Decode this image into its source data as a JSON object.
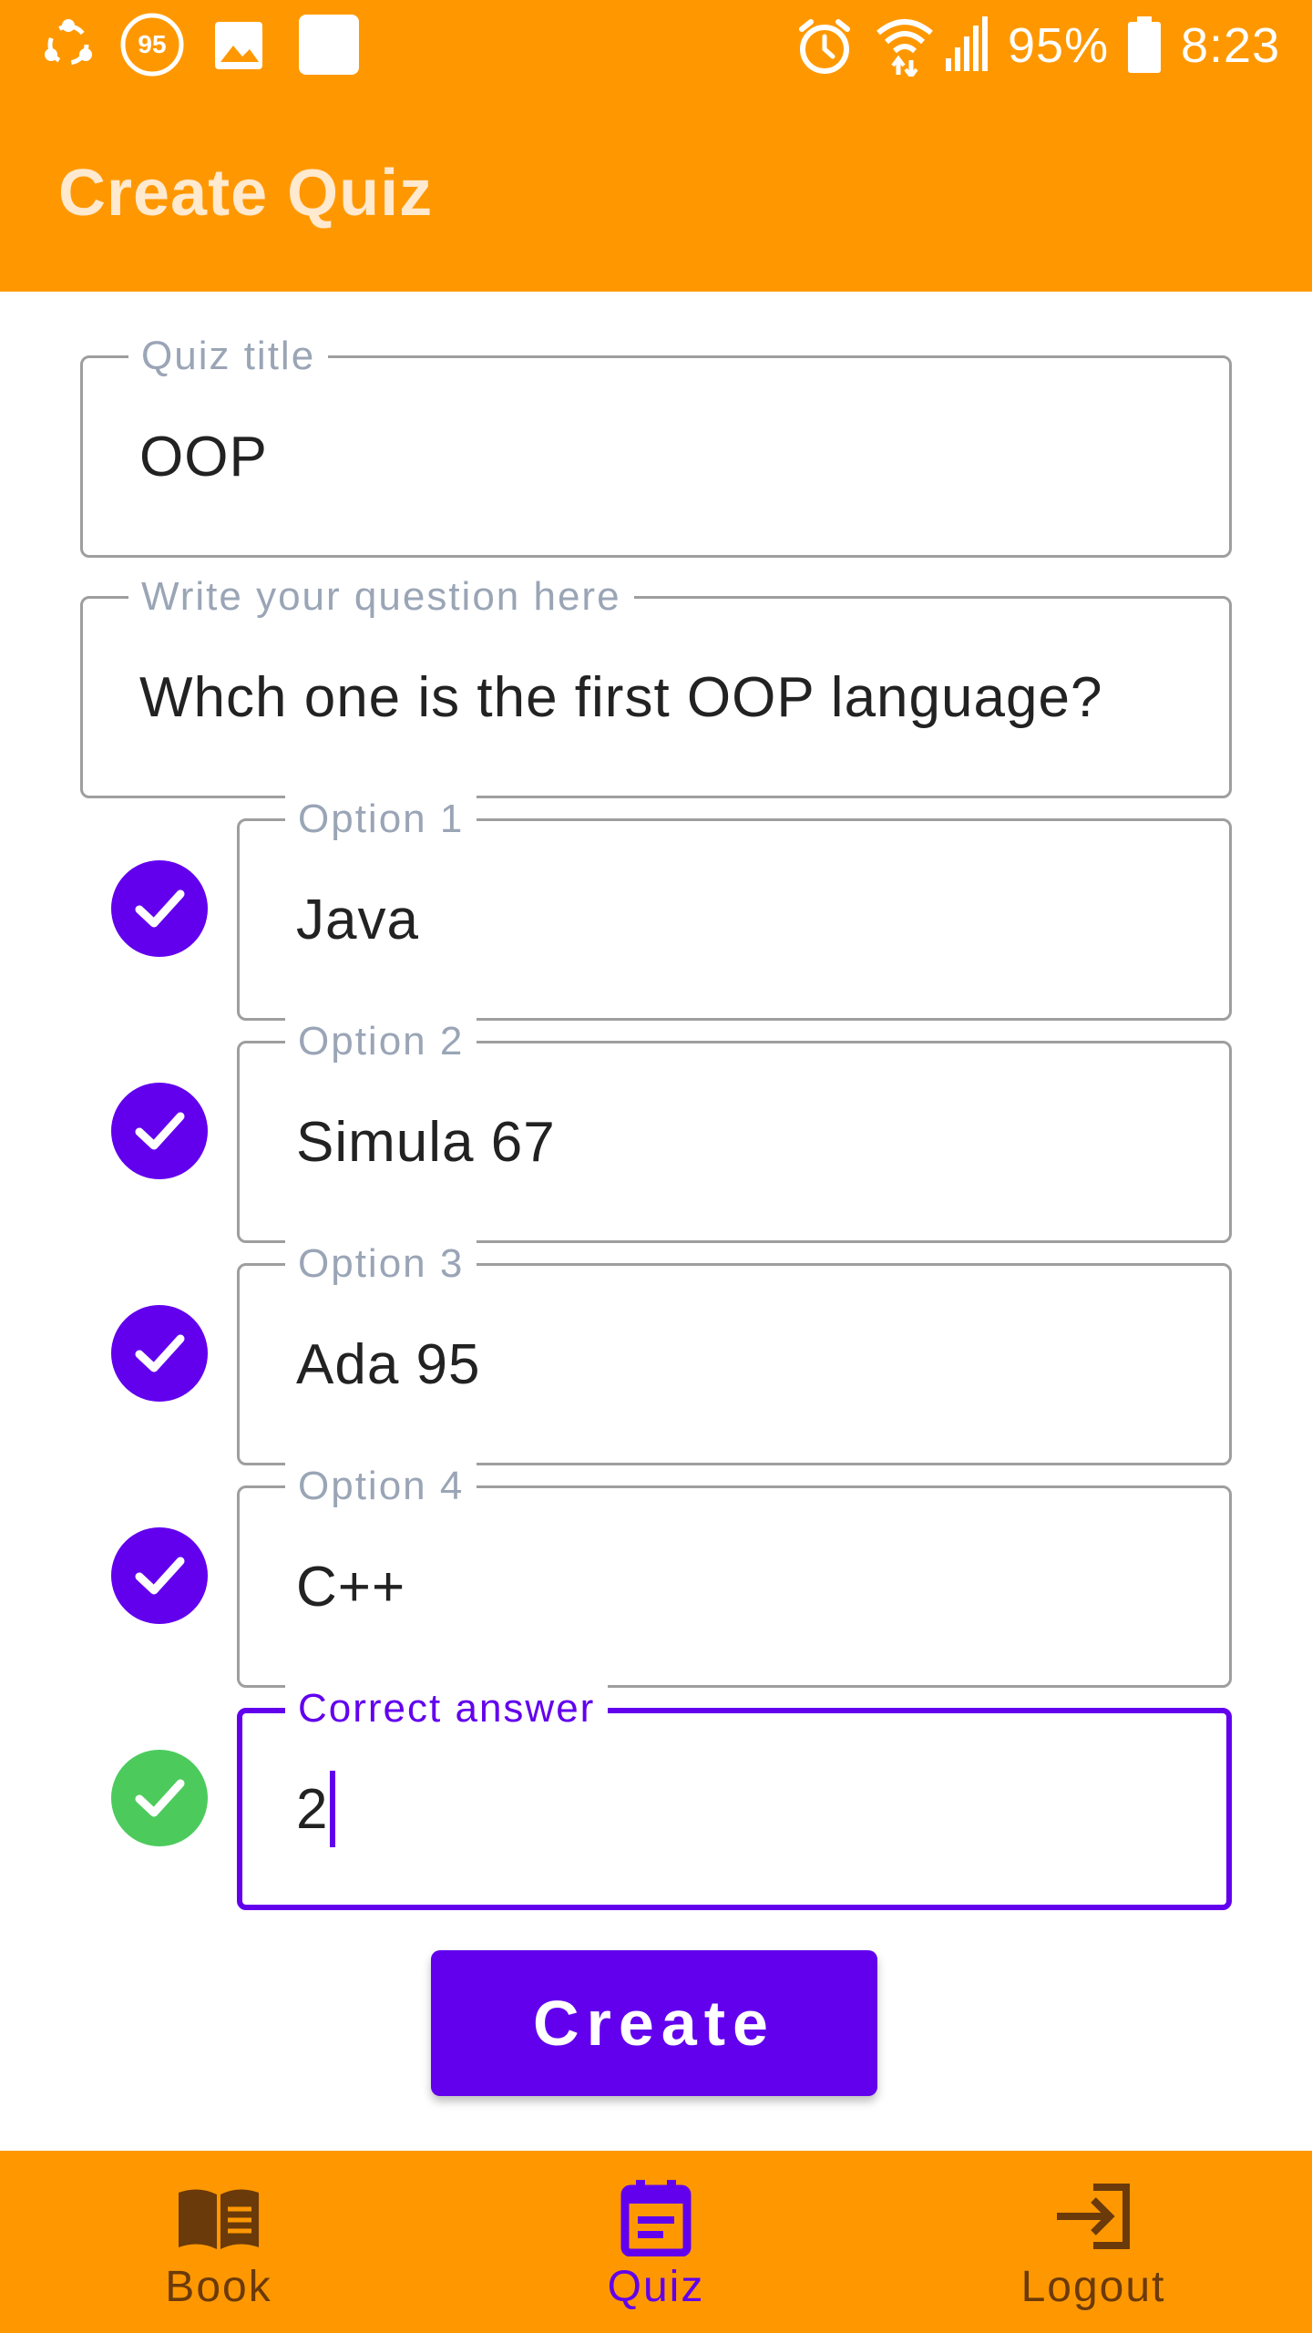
{
  "status_bar": {
    "notification_badge": "95",
    "battery_percent": "95%",
    "time": "8:23"
  },
  "app_bar": {
    "title": "Create Quiz"
  },
  "form": {
    "quiz_title": {
      "label": "Quiz title",
      "value": "OOP"
    },
    "question": {
      "label": "Write your question here",
      "value": "Whch one is the first OOP language?"
    },
    "options": [
      {
        "label": "Option 1",
        "value": "Java"
      },
      {
        "label": "Option 2",
        "value": "Simula 67"
      },
      {
        "label": "Option 3",
        "value": "Ada 95"
      },
      {
        "label": "Option 4",
        "value": "C++"
      }
    ],
    "correct_answer": {
      "label": "Correct answer",
      "value": "2"
    }
  },
  "create_button": {
    "label": "Create"
  },
  "bottom_nav": {
    "items": [
      {
        "label": "Book",
        "icon": "book-icon",
        "active": false
      },
      {
        "label": "Quiz",
        "icon": "quiz-icon",
        "active": true
      },
      {
        "label": "Logout",
        "icon": "logout-icon",
        "active": false
      }
    ]
  },
  "colors": {
    "app_bar": "#FF9800",
    "accent": "#6200EE",
    "check_green": "#4CCB5C",
    "nav_inactive": "#6B3A0A"
  }
}
